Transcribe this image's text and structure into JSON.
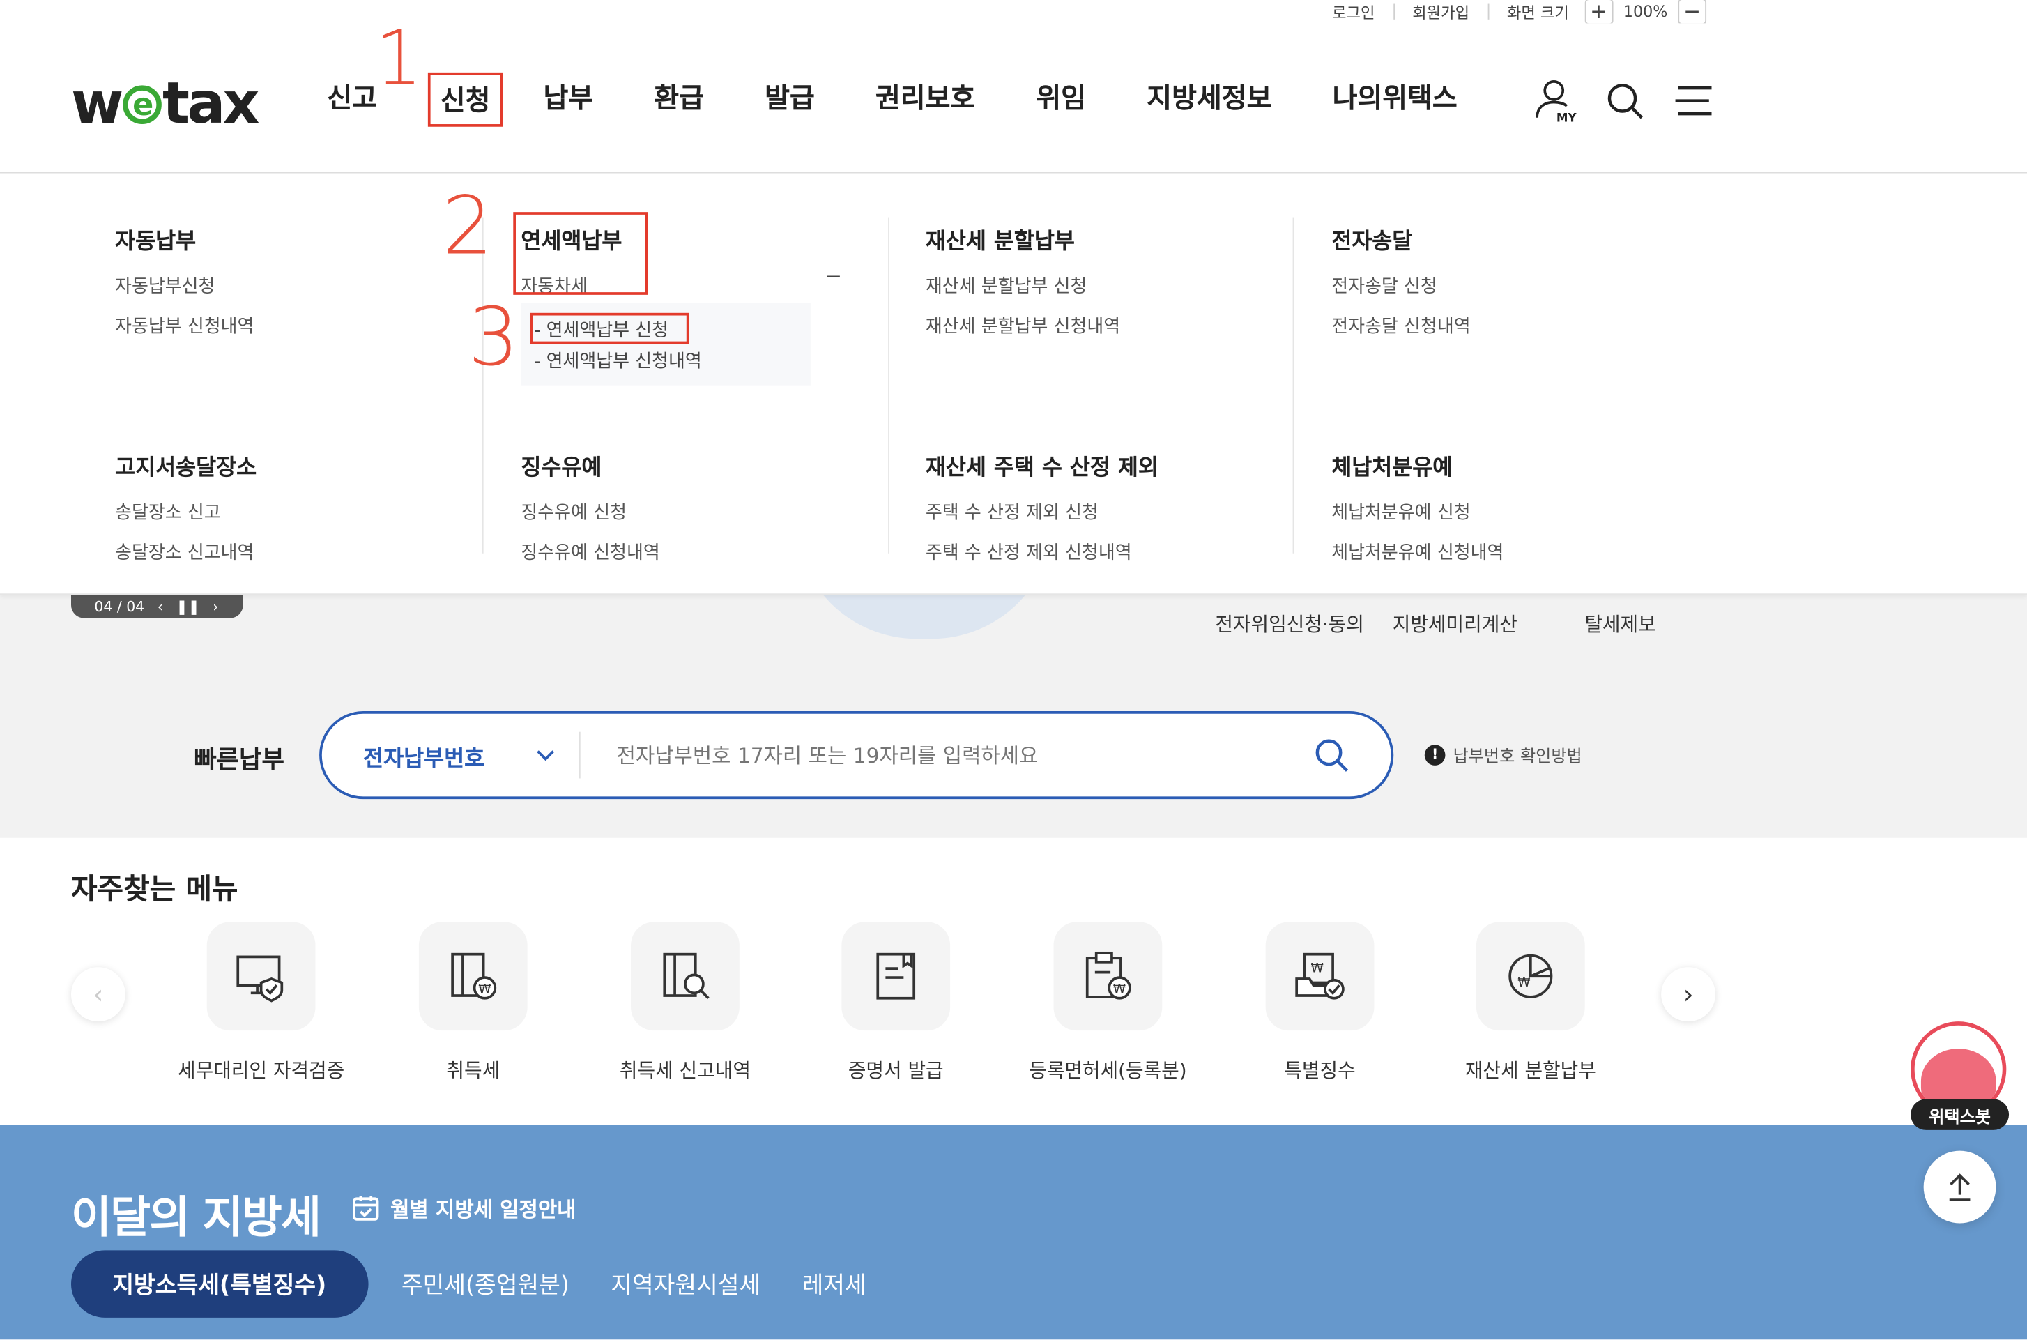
{
  "util": {
    "login": "로그인",
    "signup": "회원가입",
    "zoom_label": "화면 크기",
    "zoom_in": "+",
    "zoom_value": "100%",
    "zoom_out": "−"
  },
  "header": {
    "logo_pre": "w",
    "logo_e": "e",
    "logo_post": "tax",
    "gnb": [
      "신고",
      "신청",
      "납부",
      "환급",
      "발급",
      "권리보호",
      "위임",
      "지방세정보",
      "나의위택스"
    ],
    "my_label": "MY"
  },
  "annotations": {
    "n1": "1",
    "n2": "2",
    "n3": "3"
  },
  "mega": {
    "auto_pay": {
      "title": "자동납부",
      "items": [
        "자동납부신청",
        "자동납부 신청내역"
      ]
    },
    "annual": {
      "title": "연세액납부",
      "item": "자동차세",
      "toggle": "−",
      "sub": [
        "- 연세액납부 신청",
        "- 연세액납부 신청내역"
      ]
    },
    "property_split": {
      "title": "재산세 분할납부",
      "items": [
        "재산세 분할납부 신청",
        "재산세 분할납부 신청내역"
      ]
    },
    "e_delivery": {
      "title": "전자송달",
      "items": [
        "전자송달 신청",
        "전자송달 신청내역"
      ]
    },
    "notice_place": {
      "title": "고지서송달장소",
      "items": [
        "송달장소 신고",
        "송달장소 신고내역"
      ]
    },
    "deferral": {
      "title": "징수유예",
      "items": [
        "징수유예 신청",
        "징수유예 신청내역"
      ]
    },
    "house_exclude": {
      "title": "재산세 주택 수 산정 제외",
      "items": [
        "주택 수 산정 제외 신청",
        "주택 수 산정 제외 신청내역"
      ]
    },
    "arrears": {
      "title": "체납처분유예",
      "items": [
        "체납처분유예 신청",
        "체납처분유예 신청내역"
      ]
    }
  },
  "hero": {
    "slider_counter": "04 / 04",
    "links": [
      "전자위임신청·동의",
      "지방세미리계산",
      "탈세제보"
    ]
  },
  "quickpay": {
    "label": "빠른납부",
    "select_value": "전자납부번호",
    "placeholder": "전자납부번호 17자리 또는 19자리를 입력하세요",
    "help": "납부번호 확인방법"
  },
  "frequent": {
    "title": "자주찾는 메뉴",
    "items": [
      "세무대리인 자격검증",
      "취득세",
      "취득세 신고내역",
      "증명서 발급",
      "등록면허세(등록분)",
      "특별징수",
      "재산세 분할납부"
    ]
  },
  "chatbot": {
    "label": "위택스봇"
  },
  "monthly": {
    "title": "이달의 지방세",
    "schedule_link": "월별 지방세 일정안내",
    "tabs": [
      "지방소득세(특별징수)",
      "주민세(종업원분)",
      "지역자원시설세",
      "레저세"
    ]
  },
  "colors": {
    "brand_green": "#3aa935",
    "accent_blue": "#2b5cb5",
    "annotation_red": "#e33b2c",
    "section_blue": "#6698cc",
    "tab_active": "#1f3f7d"
  }
}
